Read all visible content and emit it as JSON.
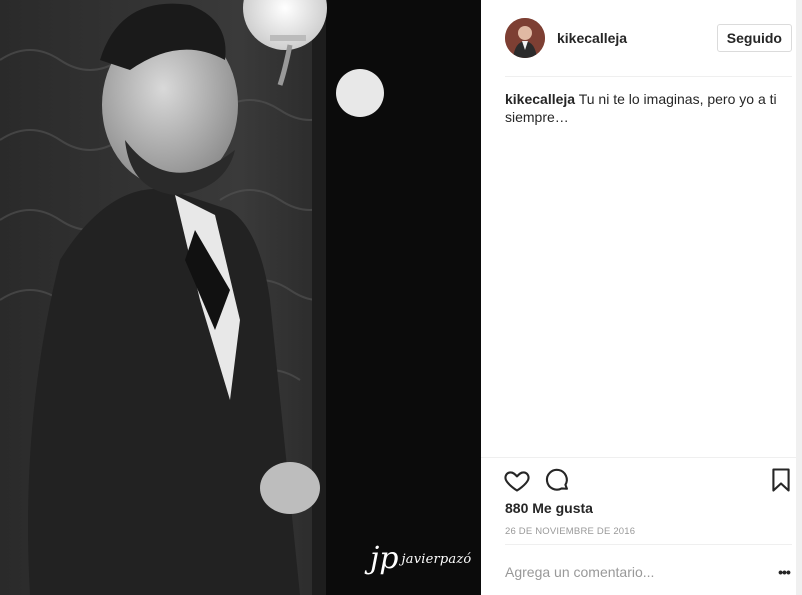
{
  "post": {
    "username": "kikecalleja",
    "follow_button": "Seguido",
    "caption_user": "kikecalleja",
    "caption_text": "Tu ni te lo imaginas, pero yo a ti siempre…",
    "likes": "880 Me gusta",
    "date": "26 DE NOVIEMBRE DE 2016",
    "comment_placeholder": "Agrega un comentario...",
    "more_options": "•••"
  },
  "photo": {
    "watermark_mark": "jp",
    "watermark_text": "javierpazó"
  },
  "icons": {
    "like": "heart-icon",
    "comment": "comment-icon",
    "save": "bookmark-icon",
    "more": "ellipsis-icon"
  },
  "colors": {
    "text": "#262626",
    "muted": "#999999",
    "divider": "#efefef",
    "button_border": "#dbdbdb"
  }
}
